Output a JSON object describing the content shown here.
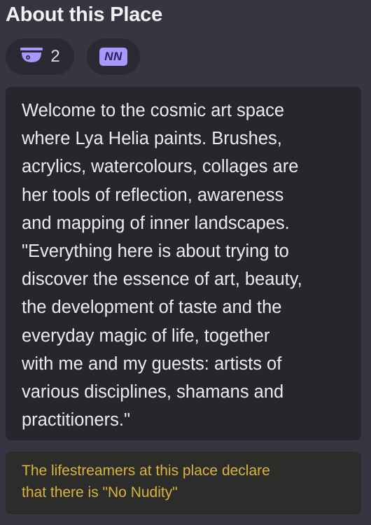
{
  "section": {
    "title": "About this Place"
  },
  "badges": {
    "viewers": {
      "icon": "camera-dome-icon",
      "count": "2"
    },
    "rating": {
      "label": "NN"
    }
  },
  "description": {
    "text": "Welcome to the cosmic art space\nwhere Lya Helia paints. Brushes,\nacrylics, watercolours, collages are\nher tools of reflection, awareness\nand mapping of inner landscapes.\n\"Everything here is about trying to\ndiscover the essence of art, beauty,\nthe development of taste and the\neveryday magic of life, together\nwith me and my guests: artists of\nvarious disciplines, shamans and\npractitioners.\""
  },
  "notice": {
    "text": "The lifestreamers at this place declare\nthat there is \"No Nudity\""
  },
  "colors": {
    "background": "#363541",
    "accent": "#a897ff",
    "notice_text": "#d9b53a"
  }
}
